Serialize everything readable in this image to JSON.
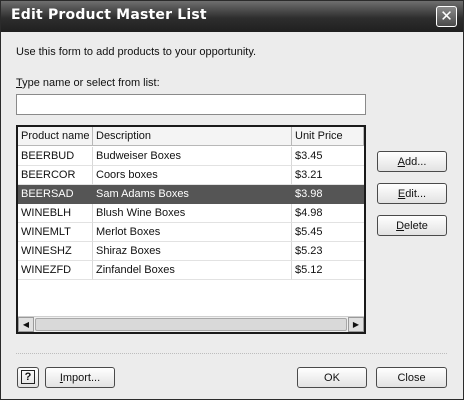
{
  "window": {
    "title": "Edit Product Master List",
    "close_glyph": "✕",
    "close_icon": "close-icon"
  },
  "intro_text": "Use this form to add products to your opportunity.",
  "field": {
    "label_prefix": "T",
    "label_rest": "ype name or select from list:",
    "value": "",
    "placeholder": ""
  },
  "list": {
    "columns": [
      "Product name",
      "Description",
      "Unit Price"
    ],
    "rows": [
      {
        "name": "BEERBUD",
        "description": "Budweiser Boxes",
        "price": "$3.45",
        "selected": false
      },
      {
        "name": "BEERCOR",
        "description": "Coors boxes",
        "price": "$3.21",
        "selected": false
      },
      {
        "name": "BEERSAD",
        "description": "Sam Adams Boxes",
        "price": "$3.98",
        "selected": true
      },
      {
        "name": "WINEBLH",
        "description": "Blush Wine Boxes",
        "price": "$4.98",
        "selected": false
      },
      {
        "name": "WINEMLT",
        "description": "Merlot Boxes",
        "price": "$5.45",
        "selected": false
      },
      {
        "name": "WINESHZ",
        "description": "Shiraz Boxes",
        "price": "$5.23",
        "selected": false
      },
      {
        "name": "WINEZFD",
        "description": "Zinfandel Boxes",
        "price": "$5.12",
        "selected": false
      }
    ],
    "scroll_left_glyph": "◀",
    "scroll_right_glyph": "▶"
  },
  "side_buttons": {
    "add_mnemonic": "A",
    "add_rest": "dd...",
    "edit_mnemonic": "E",
    "edit_rest": "dit...",
    "delete_mnemonic": "D",
    "delete_rest": "elete"
  },
  "bottom_buttons": {
    "help_glyph": "?",
    "import_mnemonic": "I",
    "import_rest": "mport...",
    "ok_label": "OK",
    "close_label": "Close"
  },
  "colors": {
    "selection": "#555555",
    "titlebar": "#2e2e2e"
  }
}
